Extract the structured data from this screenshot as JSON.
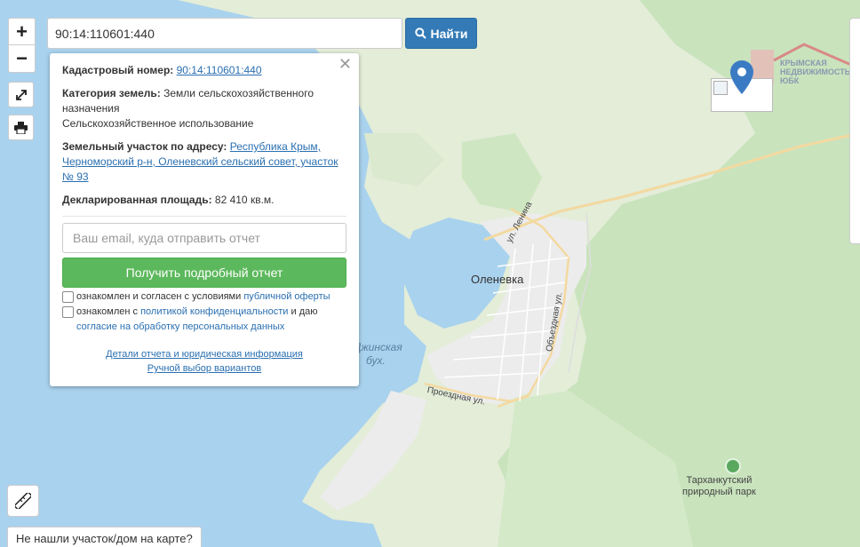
{
  "search": {
    "query": "90:14:110601:440",
    "button_label": "Найти",
    "button_icon": "search-icon"
  },
  "controls": {
    "zoom_in": "+",
    "zoom_out": "−",
    "fullscreen_icon": "expand-icon",
    "print_icon": "print-icon",
    "ruler_icon": "ruler-icon"
  },
  "popup": {
    "close": "✕",
    "cadastral_label": "Кадастровый номер:",
    "cadastral_value": "90:14:110601:440",
    "category_label": "Категория земель:",
    "category_value": "Земли сельскохозяйственного назначения",
    "category_use": "Сельскохозяйственное использование",
    "address_label": "Земельный участок по адресу:",
    "address_value": "Республика Крым, Черноморский р-н, Оленевский сельский совет, участок № 93",
    "area_label": "Декларированная площадь:",
    "area_value": "82 410 кв.м.",
    "email_placeholder": "Ваш email, куда отправить отчет",
    "report_button": "Получить подробный отчет",
    "consent1_text": "ознакомлен и согласен с условиями",
    "consent1_link": "публичной оферты",
    "consent2_text": "ознакомлен с",
    "consent2_link1": "политикой конфиденциальности",
    "consent2_mid": "и даю",
    "consent2_link2": "согласие на обработку персональных данных",
    "details_link": "Детали отчета и юридическая информация",
    "manual_link": "Ручной выбор вариантов"
  },
  "map": {
    "town": "Оленевка",
    "street_lenin": "ул. Ленина",
    "street_obezd": "Объездная ул.",
    "street_proezd": "Проездная ул.",
    "bay_line1": "Джинская",
    "bay_line2": "бух.",
    "park_line1": "Тарханкутский",
    "park_line2": "природный парк",
    "marker_icon": "map-pin-icon",
    "colors": {
      "water": "#a9d2ee",
      "land": "#e3edd8",
      "forest": "#c9e3bd",
      "town": "#ececec",
      "road": "#f3d9a0",
      "marker": "#3b7bc4"
    }
  },
  "logo": {
    "line1": "КРЫМСКАЯ",
    "line2": "НЕДВИЖИМОСТЬ",
    "line3": "ЮБК"
  },
  "bottom": {
    "not_found": "Не нашли участок/дом на карте?"
  }
}
